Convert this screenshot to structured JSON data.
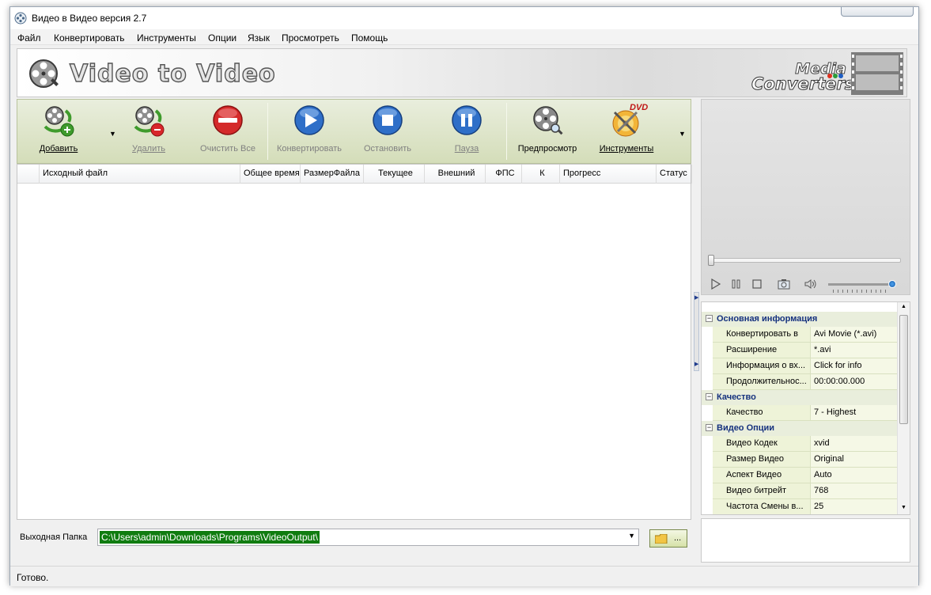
{
  "window": {
    "title": "Видео в Видео версия 2.7"
  },
  "menu": [
    "Файл",
    "Конвертировать",
    "Инструменты",
    "Опции",
    "Язык",
    "Просмотреть",
    "Помощь"
  ],
  "banner": {
    "app_title": "Video to Video",
    "brand_line1": "Media",
    "brand_line2": "Converters",
    "brand_dot_colors": [
      "#e0301e",
      "#2a9d3a",
      "#1f5fc4"
    ]
  },
  "toolbar": {
    "add": "Добавить",
    "remove": "Удалить",
    "clear_all": "Очистить Все",
    "convert": "Конвертировать",
    "stop": "Остановить",
    "pause": "Пауза",
    "preview": "Предпросмотр",
    "tools": "Инструменты",
    "dvd_badge": "DVD"
  },
  "table": {
    "columns": [
      "Исходный файл",
      "Общее время",
      "РазмерФайла",
      "Текущее",
      "Внешний",
      "ФПС",
      "К",
      "Прогресс",
      "Статус"
    ]
  },
  "output": {
    "label": "Выходная Папка",
    "path": "C:\\Users\\admin\\Downloads\\Programs\\VideoOutput\\",
    "browse": "..."
  },
  "properties": {
    "basic": {
      "title": "Основная информация",
      "rows": [
        {
          "name": "Конвертировать в",
          "value": "Avi Movie (*.avi)"
        },
        {
          "name": "Расширение",
          "value": "*.avi"
        },
        {
          "name": "Информация о вх...",
          "value": "Click for info"
        },
        {
          "name": "Продолжительнос...",
          "value": "00:00:00.000"
        }
      ]
    },
    "quality": {
      "title": "Качество",
      "rows": [
        {
          "name": "Качество",
          "value": "7 - Highest"
        }
      ]
    },
    "video": {
      "title": "Видео Опции",
      "rows": [
        {
          "name": "Видео Кодек",
          "value": "xvid"
        },
        {
          "name": "Размер Видео",
          "value": "Original"
        },
        {
          "name": "Аспект Видео",
          "value": "Auto"
        },
        {
          "name": "Видео битрейт",
          "value": "768"
        },
        {
          "name": "Частота Смены в...",
          "value": "25"
        }
      ]
    }
  },
  "status": {
    "text": "Готово."
  },
  "colors": {
    "toolbar_bg": "#d4ddb9",
    "category_text": "#15317e",
    "selection": "#107c10"
  }
}
